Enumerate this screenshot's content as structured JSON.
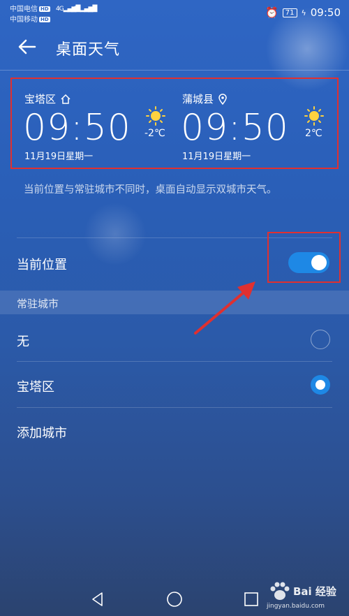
{
  "status": {
    "carrier1": "中国电信",
    "carrier2": "中国移动",
    "hd": "HD",
    "signal1": "4G",
    "signal2": "4G",
    "battery": "71",
    "time": "09:50"
  },
  "appbar": {
    "title": "桌面天气"
  },
  "weather": {
    "left": {
      "city": "宝塔区",
      "time": "09:50",
      "date": "11月19日星期一",
      "temp": "-2℃"
    },
    "right": {
      "city": "蒲城县",
      "time": "09:50",
      "date": "11月19日星期一",
      "temp": "2℃"
    }
  },
  "description": "当前位置与常驻城市不同时，桌面自动显示双城市天气。",
  "current_location": {
    "label": "当前位置",
    "enabled": true
  },
  "resident_section": {
    "header": "常驻城市"
  },
  "options": [
    {
      "label": "无",
      "selected": false
    },
    {
      "label": "宝塔区",
      "selected": true
    }
  ],
  "add_city": "添加城市",
  "watermark": {
    "text": "Bai 经验",
    "url": "jingyan.baidu.com"
  },
  "colors": {
    "accent": "#1e88e5",
    "highlight": "#e03030"
  }
}
